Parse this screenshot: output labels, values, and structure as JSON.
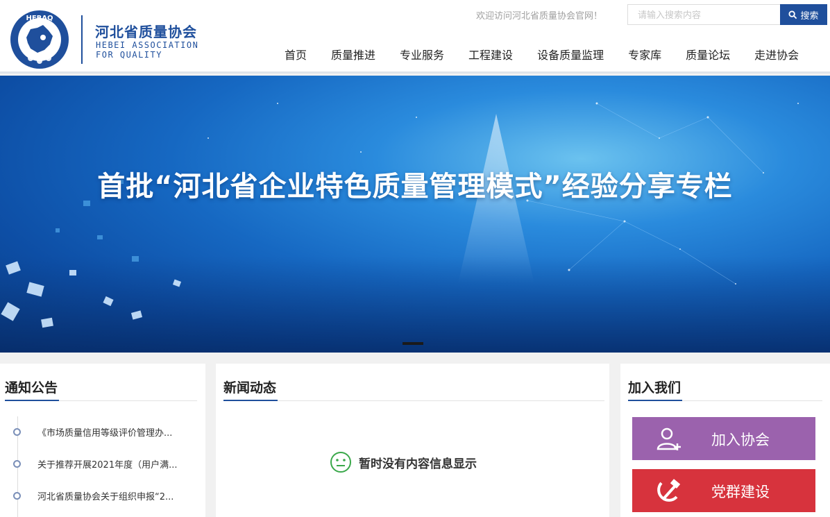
{
  "header": {
    "logo_cn": "河北省质量协会",
    "logo_en_line1": "HEBEI ASSOCIATION",
    "logo_en_line2": "FOR QUALITY",
    "logo_badge_text": "HEBAQ",
    "welcome": "欢迎访问河北省质量协会官网！",
    "search_placeholder": "请输入搜索内容",
    "search_label": "搜索",
    "brand_color": "#1f4f9c"
  },
  "nav": [
    {
      "label": "首页"
    },
    {
      "label": "质量推进"
    },
    {
      "label": "专业服务"
    },
    {
      "label": "工程建设"
    },
    {
      "label": "设备质量监理"
    },
    {
      "label": "专家库"
    },
    {
      "label": "质量论坛"
    },
    {
      "label": "走进协会"
    }
  ],
  "banner": {
    "title": "首批“河北省企业特色质量管理模式”经验分享专栏"
  },
  "notices": {
    "title": "通知公告",
    "items": [
      {
        "text": "《市场质量信用等级评价管理办..."
      },
      {
        "text": "关于推荐开展2021年度（用户满..."
      },
      {
        "text": "河北省质量协会关于组织申报“2..."
      }
    ]
  },
  "news": {
    "title": "新闻动态",
    "empty_text": "暂时没有内容信息显示"
  },
  "join": {
    "title": "加入我们",
    "join_label": "加入协会",
    "party_label": "党群建设",
    "join_color": "#9b62ad",
    "party_color": "#d7333d"
  }
}
